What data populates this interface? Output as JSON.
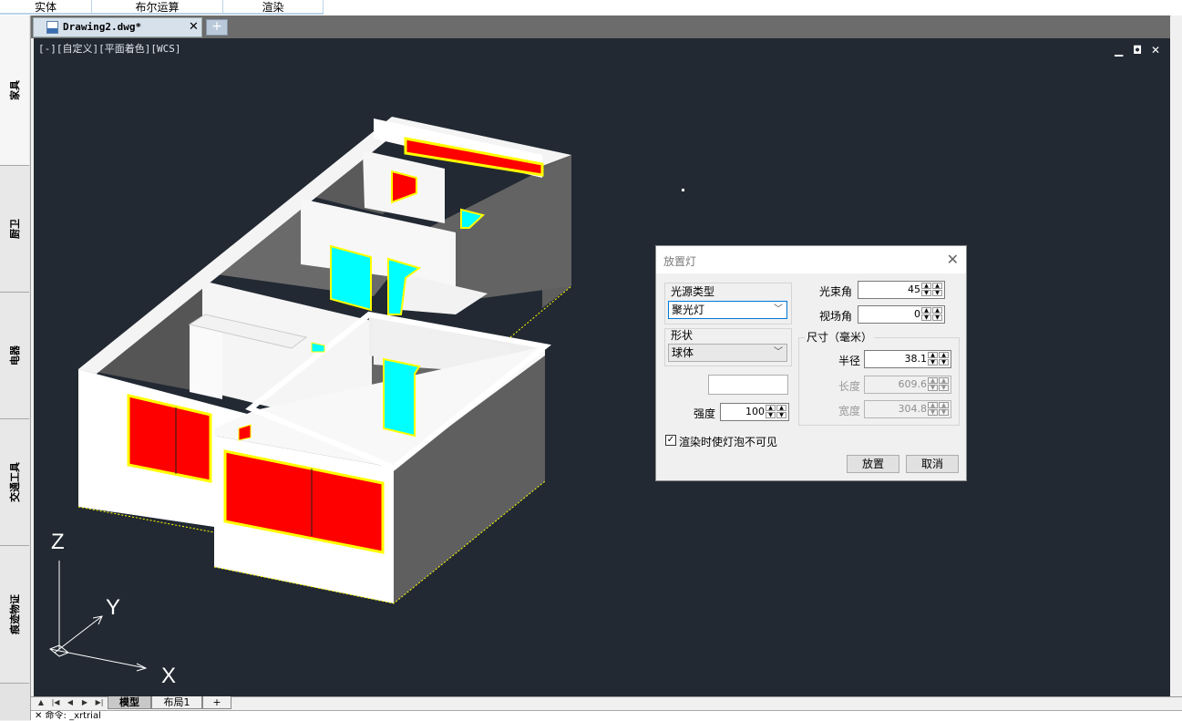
{
  "top_tabs": [
    "实体",
    "布尔运算",
    "渲染"
  ],
  "left_tabs": [
    "家具",
    "厨卫",
    "电器",
    "交通工具",
    "痕迹物证"
  ],
  "document": {
    "tab_title": "Drawing2.dwg*",
    "close": "✕",
    "new_tab": "+"
  },
  "viewport": {
    "label": "[-][自定义][平面着色][WCS]",
    "axes": {
      "z": "Z",
      "y": "Y",
      "x": "X"
    },
    "controls": {
      "minimize": "▁",
      "restore": "◘",
      "close": "✕"
    }
  },
  "layout_tabs": [
    "模型",
    "布局1",
    "+"
  ],
  "command_line": "✕ 命令: _xrtrial",
  "dialog": {
    "title": "放置灯",
    "light_type_label": "光源类型",
    "light_type_value": "聚光灯",
    "shape_label": "形状",
    "shape_value": "球体",
    "beam_angle_label": "光束角",
    "beam_angle_value": "45",
    "field_angle_label": "视场角",
    "field_angle_value": "0",
    "size_group_label": "尺寸（毫米）",
    "radius_label": "半径",
    "radius_value": "38.1",
    "length_label": "长度",
    "length_value": "609.6",
    "width_label": "宽度",
    "width_value": "304.8",
    "intensity_label": "强度",
    "intensity_value": "100",
    "invisible_bulb_label": "渲染时使灯泡不可见",
    "invisible_bulb_checked": true,
    "place_button": "放置",
    "cancel_button": "取消"
  },
  "colors": {
    "viewport_bg": "#222933",
    "wall_white": "#ffffff",
    "wall_side": "#5f5f5f",
    "window_red": "#ff0000",
    "door_cyan": "#00ffff",
    "frame_yellow": "#ffff00"
  }
}
